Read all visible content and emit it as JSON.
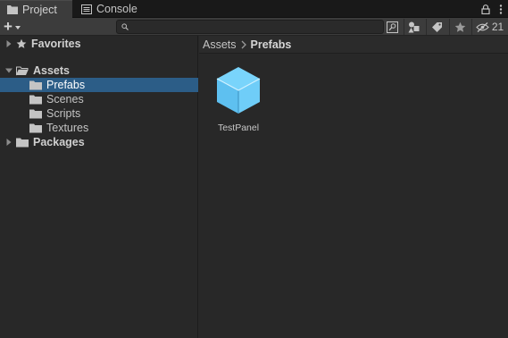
{
  "tabs": [
    {
      "label": "Project",
      "icon": "folder-icon",
      "active": true
    },
    {
      "label": "Console",
      "icon": "console-icon",
      "active": false
    }
  ],
  "tab_actions": {
    "lock_icon": "lock-icon",
    "menu_icon": "kebab-menu-icon"
  },
  "toolbar": {
    "create_icon": "plus-icon",
    "search": {
      "value": "",
      "placeholder": ""
    },
    "hidden_count": "21"
  },
  "tree": {
    "items": [
      {
        "label": "Favorites",
        "icon": "star-icon",
        "expanded": false,
        "bold": true
      },
      {
        "label": "Assets",
        "icon": "folder-open-icon",
        "expanded": true,
        "bold": true
      },
      {
        "label": "Prefabs",
        "icon": "folder-icon",
        "selected": true
      },
      {
        "label": "Scenes",
        "icon": "folder-icon"
      },
      {
        "label": "Scripts",
        "icon": "folder-icon"
      },
      {
        "label": "Textures",
        "icon": "folder-icon"
      },
      {
        "label": "Packages",
        "icon": "folder-icon",
        "expanded": false,
        "bold": true
      }
    ]
  },
  "breadcrumb": {
    "items": [
      "Assets",
      "Prefabs"
    ]
  },
  "assets": [
    {
      "name": "TestPanel",
      "icon": "prefab-cube-icon"
    }
  ],
  "colors": {
    "selection": "#2c5d87",
    "prefab_cube_light": "#79d4fb",
    "prefab_cube_dark": "#3fa7e0"
  }
}
